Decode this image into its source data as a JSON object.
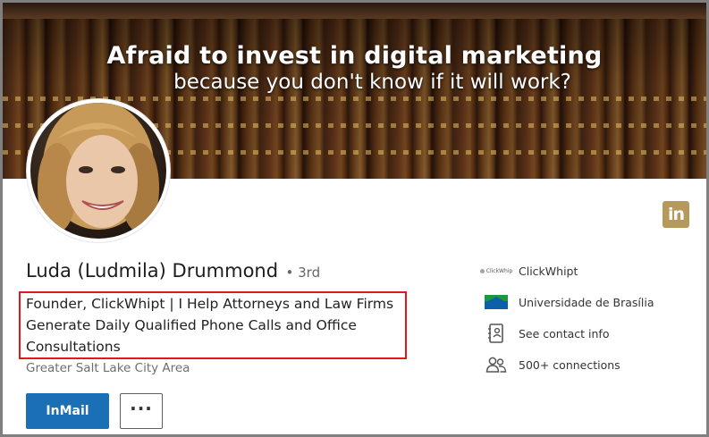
{
  "banner": {
    "headline": "Afraid to invest in digital marketing",
    "subheadline": "because you don't know if it will work?"
  },
  "profile": {
    "name": "Luda (Ludmila) Drummond",
    "degree": "• 3rd",
    "headline": "Founder, ClickWhipt | I Help Attorneys and Law Firms Generate Daily Qualified Phone Calls and Office Consultations",
    "location": "Greater Salt Lake City Area"
  },
  "actions": {
    "inmail_label": "InMail",
    "more_label": "···"
  },
  "linkedin_badge": "in",
  "sidebar": {
    "items": [
      {
        "label": "ClickWhipt",
        "icon": "clickwhipt-logo-icon",
        "logo_text": "ClickWhip"
      },
      {
        "label": "Universidade de Brasília",
        "icon": "university-logo-icon"
      },
      {
        "label": "See contact info",
        "icon": "contact-card-icon"
      },
      {
        "label": "500+ connections",
        "icon": "people-icon"
      }
    ]
  },
  "colors": {
    "primary_button": "#1b6fb4",
    "highlight_box": "#e0191e",
    "linkedin_badge": "#b59a5b"
  }
}
